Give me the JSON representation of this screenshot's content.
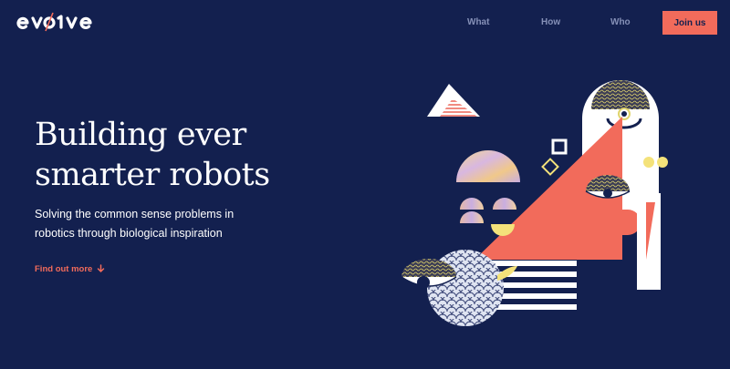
{
  "brand": {
    "name": "evolve"
  },
  "nav": {
    "links": [
      {
        "label": "What"
      },
      {
        "label": "How"
      },
      {
        "label": "Who"
      }
    ],
    "cta_label": "Join us"
  },
  "hero": {
    "title_line1": "Building ever",
    "title_line2": "smarter robots",
    "subtitle_line1": "Solving the common sense problems in",
    "subtitle_line2": "robotics through biological inspiration",
    "link_label": "Find out more",
    "link_icon": "arrow-down-icon"
  },
  "colors": {
    "background": "#13204f",
    "accent": "#f26b5b",
    "nav_text": "#8590b7",
    "yellow": "#f4e27a",
    "lavender": "#c9aee0",
    "white": "#ffffff"
  }
}
